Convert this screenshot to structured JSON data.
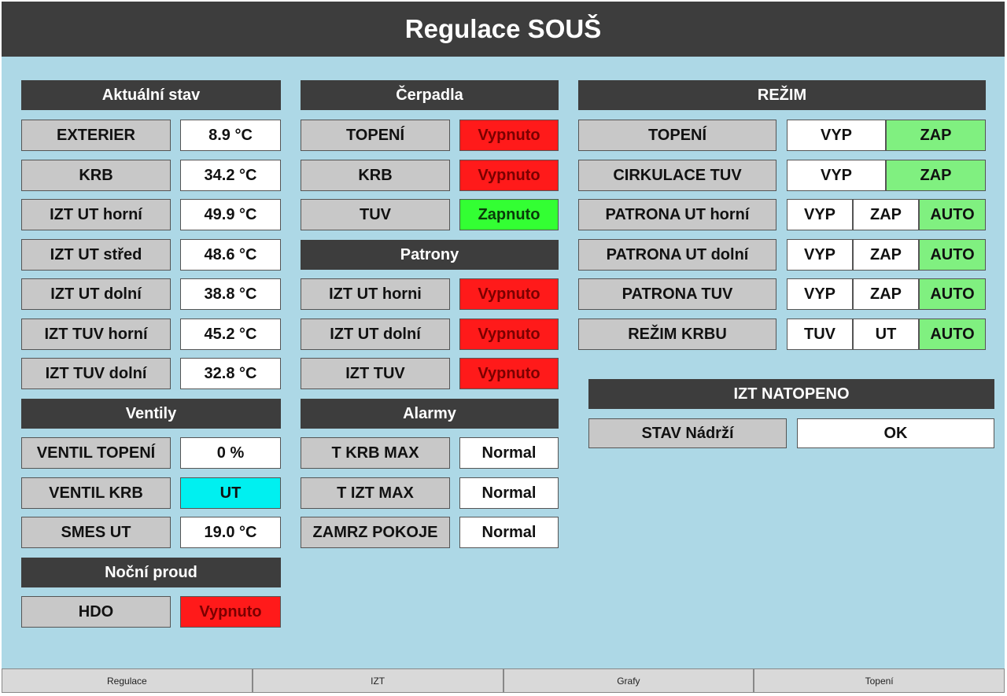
{
  "title": "Regulace SOUŠ",
  "colors": {
    "header": "#3d3d3d",
    "background": "#add8e6",
    "label": "#c8c8c8",
    "off_red": "#ff1a1a",
    "on_green": "#33ff33",
    "active_green": "#80f080",
    "cyan": "#00f0f0"
  },
  "aktualni": {
    "header": "Aktuální stav",
    "rows": [
      {
        "label": "EXTERIER",
        "value": "8.9 °C"
      },
      {
        "label": "KRB",
        "value": "34.2 °C"
      },
      {
        "label": "IZT UT horní",
        "value": "49.9 °C"
      },
      {
        "label": "IZT UT střed",
        "value": "48.6 °C"
      },
      {
        "label": "IZT UT dolní",
        "value": "38.8 °C"
      },
      {
        "label": "IZT TUV horní",
        "value": "45.2 °C"
      },
      {
        "label": "IZT TUV dolní",
        "value": "32.8 °C"
      }
    ]
  },
  "ventily": {
    "header": "Ventily",
    "rows": [
      {
        "label": "VENTIL TOPENÍ",
        "value": "0 %"
      },
      {
        "label": "VENTIL KRB",
        "value": "UT"
      },
      {
        "label": "SMES UT",
        "value": "19.0 °C"
      }
    ]
  },
  "nocni": {
    "header": "Noční proud",
    "rows": [
      {
        "label": "HDO",
        "value": "Vypnuto"
      }
    ]
  },
  "cerpadla": {
    "header": "Čerpadla",
    "rows": [
      {
        "label": "TOPENÍ",
        "value": "Vypnuto"
      },
      {
        "label": "KRB",
        "value": "Vypnuto"
      },
      {
        "label": "TUV",
        "value": "Zapnuto"
      }
    ]
  },
  "patrony": {
    "header": "Patrony",
    "rows": [
      {
        "label": "IZT UT horni",
        "value": "Vypnuto"
      },
      {
        "label": "IZT UT dolní",
        "value": "Vypnuto"
      },
      {
        "label": "IZT TUV",
        "value": "Vypnuto"
      }
    ]
  },
  "alarmy": {
    "header": "Alarmy",
    "rows": [
      {
        "label": "T KRB MAX",
        "value": "Normal"
      },
      {
        "label": "T IZT MAX",
        "value": "Normal"
      },
      {
        "label": "ZAMRZ POKOJE",
        "value": "Normal"
      }
    ]
  },
  "rezim": {
    "header": "REŽIM",
    "rows": [
      {
        "label": "TOPENÍ",
        "options": [
          "VYP",
          "ZAP"
        ],
        "active": "ZAP"
      },
      {
        "label": "CIRKULACE TUV",
        "options": [
          "VYP",
          "ZAP"
        ],
        "active": "ZAP"
      },
      {
        "label": "PATRONA UT horní",
        "options": [
          "VYP",
          "ZAP",
          "AUTO"
        ],
        "active": "AUTO"
      },
      {
        "label": "PATRONA UT dolní",
        "options": [
          "VYP",
          "ZAP",
          "AUTO"
        ],
        "active": "AUTO"
      },
      {
        "label": "PATRONA TUV",
        "options": [
          "VYP",
          "ZAP",
          "AUTO"
        ],
        "active": "AUTO"
      },
      {
        "label": "REŽIM KRBU",
        "options": [
          "TUV",
          "UT",
          "AUTO"
        ],
        "active": "AUTO"
      }
    ]
  },
  "natopeno": {
    "header": "IZT NATOPENO",
    "label": "STAV Nádrží",
    "value": "OK"
  },
  "nav": [
    "Regulace",
    "IZT",
    "Grafy",
    "Topení"
  ]
}
